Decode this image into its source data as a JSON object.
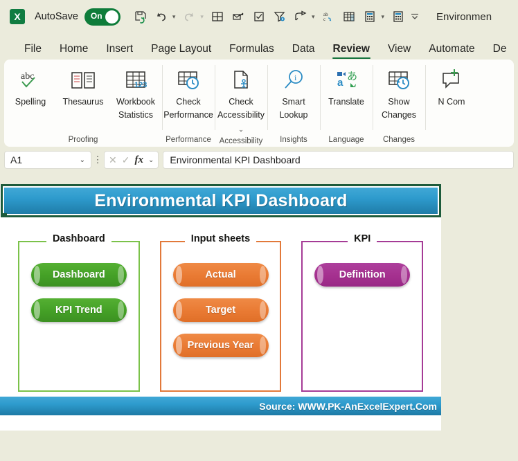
{
  "titlebar": {
    "autosave_label": "AutoSave",
    "autosave_state": "On",
    "document_title": "Environmen",
    "quick_access": [
      {
        "name": "excel-logo-icon",
        "label": "X"
      },
      {
        "name": "save-icon",
        "label": ""
      },
      {
        "name": "undo-icon",
        "label": ""
      },
      {
        "name": "redo-icon",
        "label": ""
      },
      {
        "name": "table-grid-icon",
        "label": ""
      },
      {
        "name": "attach-send-icon",
        "label": ""
      },
      {
        "name": "checkbox-icon",
        "label": ""
      },
      {
        "name": "filter-settings-icon",
        "label": ""
      },
      {
        "name": "share-icon",
        "label": ""
      },
      {
        "name": "spelling-abc-icon",
        "label": ""
      },
      {
        "name": "freeze-panes-icon",
        "label": ""
      },
      {
        "name": "calculator-icon",
        "label": ""
      },
      {
        "name": "calculator-sheet-icon",
        "label": ""
      },
      {
        "name": "customize-qat-icon",
        "label": ""
      }
    ]
  },
  "ribbon": {
    "tabs": [
      {
        "label": "File",
        "active": false
      },
      {
        "label": "Home",
        "active": false
      },
      {
        "label": "Insert",
        "active": false
      },
      {
        "label": "Page Layout",
        "active": false
      },
      {
        "label": "Formulas",
        "active": false
      },
      {
        "label": "Data",
        "active": false
      },
      {
        "label": "Review",
        "active": true
      },
      {
        "label": "View",
        "active": false
      },
      {
        "label": "Automate",
        "active": false
      },
      {
        "label": "De",
        "active": false
      }
    ],
    "groups": [
      {
        "label": "Proofing",
        "items": [
          {
            "label": "Spelling",
            "icon": "spelling-abc-check-icon",
            "dropdown": false
          },
          {
            "label": "Thesaurus",
            "icon": "thesaurus-book-icon",
            "dropdown": false
          },
          {
            "label": "Workbook Statistics",
            "icon": "workbook-statistics-icon",
            "dropdown": false
          }
        ]
      },
      {
        "label": "Performance",
        "items": [
          {
            "label": "Check Performance",
            "icon": "check-performance-icon",
            "dropdown": false
          }
        ]
      },
      {
        "label": "Accessibility",
        "items": [
          {
            "label": "Check Accessibility",
            "icon": "check-accessibility-icon",
            "dropdown": true
          }
        ]
      },
      {
        "label": "Insights",
        "items": [
          {
            "label": "Smart Lookup",
            "icon": "smart-lookup-icon",
            "dropdown": false
          }
        ]
      },
      {
        "label": "Language",
        "items": [
          {
            "label": "Translate",
            "icon": "translate-icon",
            "dropdown": false
          }
        ]
      },
      {
        "label": "Changes",
        "items": [
          {
            "label": "Show Changes",
            "icon": "show-changes-icon",
            "dropdown": false
          }
        ]
      },
      {
        "label": "",
        "items": [
          {
            "label": "N Com",
            "icon": "new-comment-icon",
            "dropdown": false
          }
        ]
      }
    ]
  },
  "formula_bar": {
    "name_box_value": "A1",
    "cancel_icon": "cancel-x-icon",
    "confirm_icon": "confirm-check-icon",
    "fx_icon": "insert-function-fx-icon",
    "formula_value": "Environmental KPI Dashboard"
  },
  "sheet": {
    "banner_title": "Environmental KPI Dashboard",
    "footer_text": "Source: WWW.PK-AnExcelExpert.Com",
    "panels": [
      {
        "title": "Dashboard",
        "color": "#7bc24a",
        "buttons": [
          {
            "label": "Dashboard",
            "style": "green"
          },
          {
            "label": "KPI Trend",
            "style": "green"
          }
        ]
      },
      {
        "title": "Input sheets",
        "color": "#e2793a",
        "buttons": [
          {
            "label": "Actual",
            "style": "orange"
          },
          {
            "label": "Target",
            "style": "orange"
          },
          {
            "label": "Previous Year",
            "style": "orange"
          }
        ]
      },
      {
        "title": "KPI",
        "color": "#a53b96",
        "buttons": [
          {
            "label": "Definition",
            "style": "purple"
          }
        ]
      }
    ]
  },
  "colors": {
    "app_chrome": "#ebebdc",
    "accent_green": "#107c41",
    "banner_blue_light": "#41a8d6",
    "banner_blue_dark": "#1f7ca8",
    "selection_green": "#1d5b3b"
  }
}
